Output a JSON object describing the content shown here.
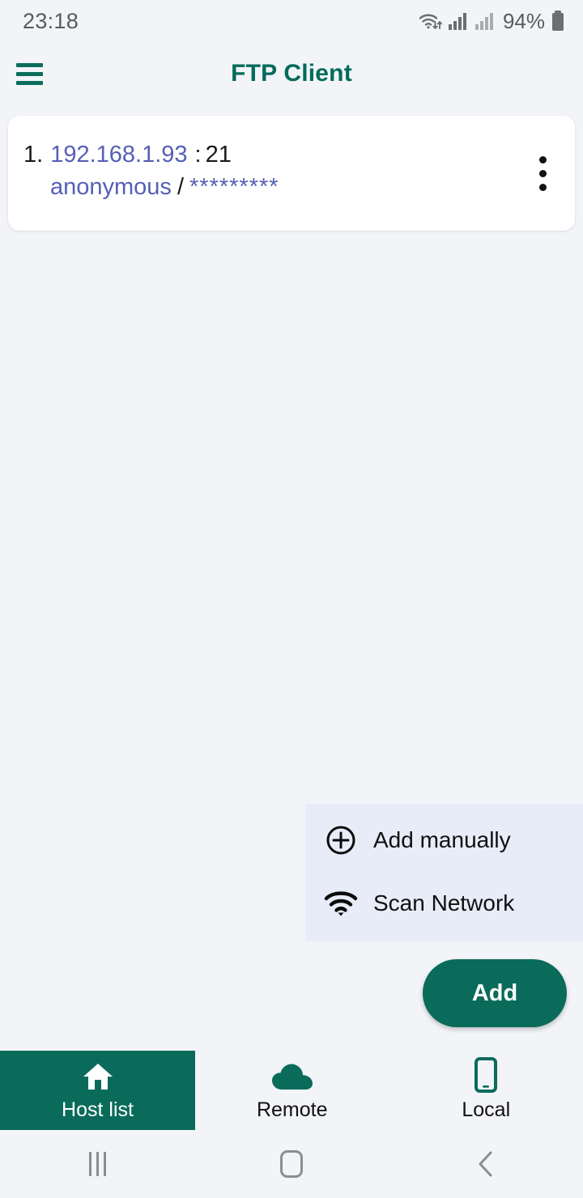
{
  "status_bar": {
    "clock": "23:18",
    "battery_percent": "94%",
    "wifi_icon": "wifi-data-icon",
    "signal_icon_1": "cellular-signal-icon",
    "signal_icon_2": "cellular-signal-icon",
    "battery_icon": "battery-icon"
  },
  "app_bar": {
    "title": "FTP Client",
    "menu_icon": "hamburger-menu-icon",
    "title_color": "#026b5a"
  },
  "host_list": {
    "items": [
      {
        "index": "1.",
        "host": "192.168.1.93",
        "separator": ":",
        "port": "21",
        "username": "anonymous",
        "slash": "/",
        "password_mask": "*********",
        "overflow_icon": "more-vertical-icon"
      }
    ]
  },
  "popup_menu": {
    "background": "#e8ecf8",
    "items": [
      {
        "label": "Add manually",
        "icon": "plus-circle-icon"
      },
      {
        "label": "Scan Network",
        "icon": "wifi-icon"
      }
    ]
  },
  "fab": {
    "label": "Add",
    "color": "#0b6b5b"
  },
  "bottom_nav": {
    "active_color": "#0b6b5b",
    "items": [
      {
        "label": "Host list",
        "icon": "home-icon",
        "active": true
      },
      {
        "label": "Remote",
        "icon": "cloud-icon",
        "active": false
      },
      {
        "label": "Local",
        "icon": "smartphone-icon",
        "active": false
      }
    ]
  },
  "system_nav": {
    "recents_icon": "recents-icon",
    "home_icon": "home-square-icon",
    "back_icon": "back-chevron-icon"
  }
}
